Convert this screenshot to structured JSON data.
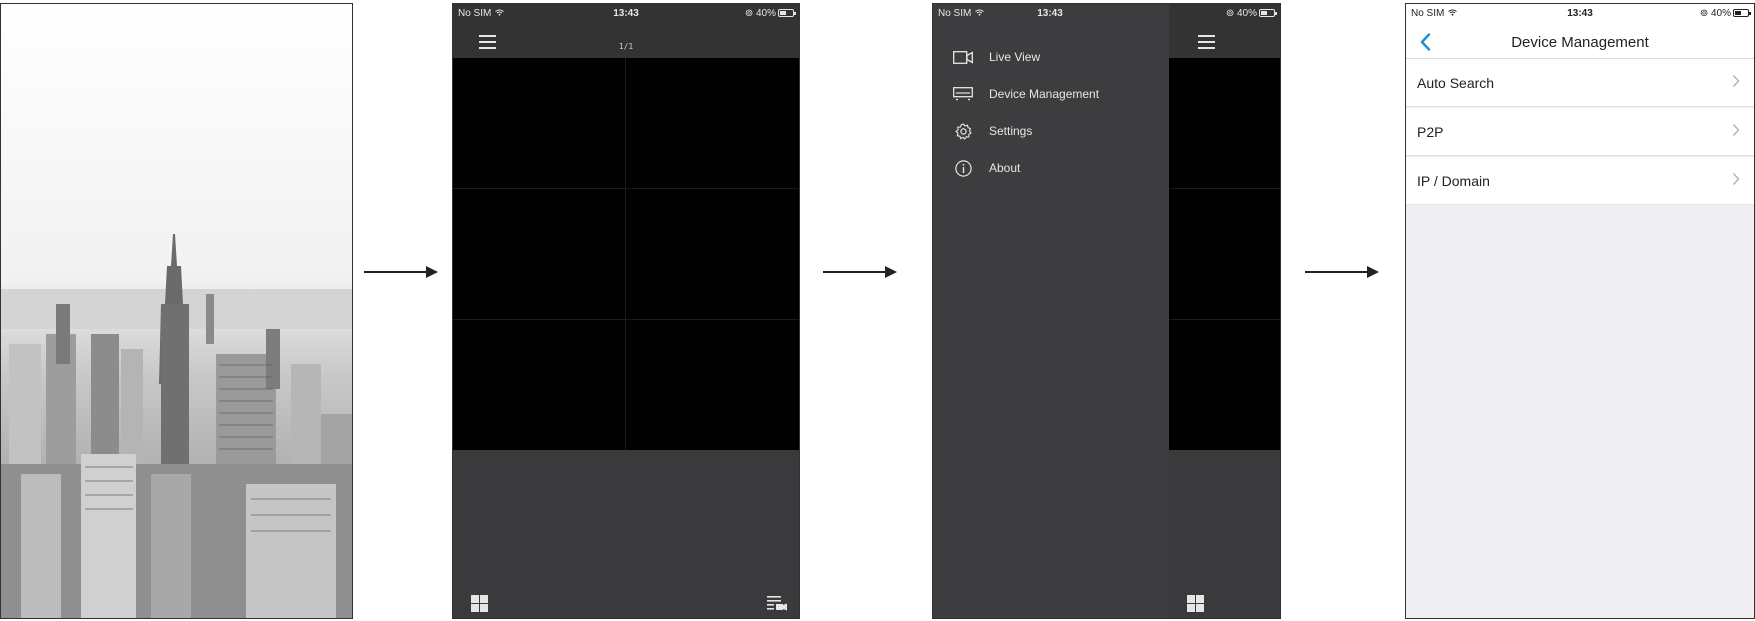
{
  "colors": {
    "dark_bg": "#3a3a3c",
    "header_bg": "#333333",
    "drawer_bg": "#3d3d3f",
    "video_bg": "#000000",
    "accent": "#1e90d0",
    "light_bg": "#efeff1"
  },
  "status_bar": {
    "carrier": "No SIM",
    "time": "13:43",
    "battery": "40%"
  },
  "live_view": {
    "page_indicator": "1/1"
  },
  "drawer": {
    "items": [
      {
        "label": "Live View",
        "icon": "video-camera-icon"
      },
      {
        "label": "Device Management",
        "icon": "dvr-device-icon"
      },
      {
        "label": "Settings",
        "icon": "gear-icon"
      },
      {
        "label": "About",
        "icon": "info-icon"
      }
    ]
  },
  "device_management": {
    "title": "Device Management",
    "rows": [
      {
        "label": "Auto Search"
      },
      {
        "label": "P2P"
      },
      {
        "label": "IP / Domain"
      }
    ]
  }
}
